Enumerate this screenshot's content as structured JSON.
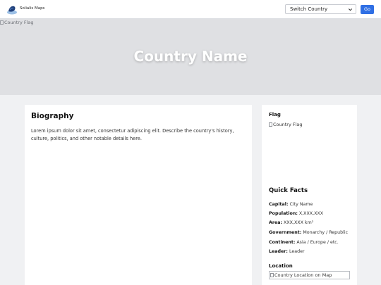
{
  "header": {
    "brand": "Solialis Maps",
    "select": {
      "selected": "Switch Country"
    },
    "go_label": "Go"
  },
  "hero": {
    "broken_image_alt": "Country Flag",
    "title": "Country Name"
  },
  "biography": {
    "title": "Biography",
    "text": "Lorem ipsum dolor sit amet, consectetur adipiscing elit. Describe the country's history, culture, politics, and other notable details here."
  },
  "sidebar": {
    "flag_heading": "Flag",
    "flag_alt": "Country Flag",
    "quick_facts_title": "Quick Facts",
    "facts": [
      {
        "label": "Capital:",
        "value": " City Name"
      },
      {
        "label": "Population:",
        "value": " X,XXX,XXX"
      },
      {
        "label": "Area:",
        "value": " XXX,XXX km²"
      },
      {
        "label": "Government:",
        "value": " Monarchy / Republic"
      },
      {
        "label": "Continent:",
        "value": " Asia / Europe / etc."
      },
      {
        "label": "Leader:",
        "value": " Leader"
      }
    ],
    "location_heading": "Location",
    "map_alt": "Country Location on Map"
  },
  "colors": {
    "accent": "#2f6fe4",
    "hero_bg": "#dfe0e3",
    "page_bg": "#f0f1f3"
  },
  "icons": [
    "globe-logo-icon",
    "chevron-down-icon",
    "broken-image-icon"
  ]
}
